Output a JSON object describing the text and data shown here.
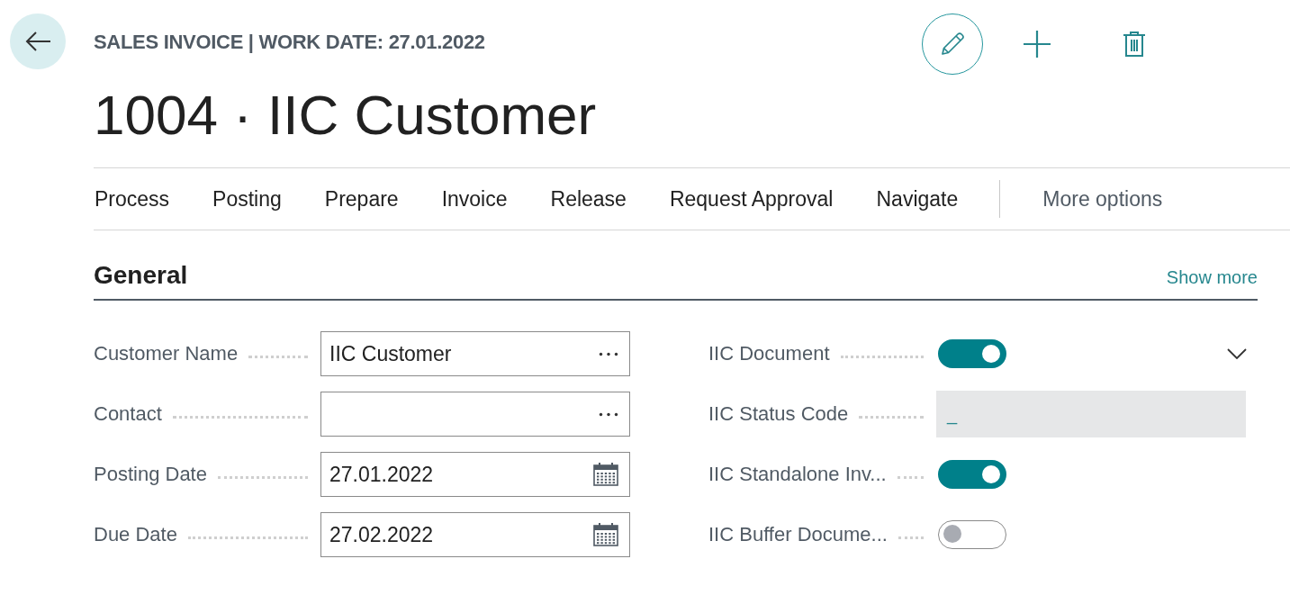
{
  "header": {
    "breadcrumb": "SALES INVOICE | WORK DATE: 27.01.2022",
    "title": "1004 · IIC Customer"
  },
  "actions": [
    {
      "label": "Process"
    },
    {
      "label": "Posting"
    },
    {
      "label": "Prepare"
    },
    {
      "label": "Invoice"
    },
    {
      "label": "Release"
    },
    {
      "label": "Request Approval"
    },
    {
      "label": "Navigate"
    }
  ],
  "more_options": "More options",
  "section": {
    "title": "General",
    "show_more": "Show more",
    "expanded": true
  },
  "left_fields": [
    {
      "kind": "lookup",
      "label": "Customer Name",
      "value": "IIC Customer"
    },
    {
      "kind": "lookup",
      "label": "Contact"
    },
    {
      "kind": "date",
      "label": "Posting Date",
      "value": "27.01.2022"
    },
    {
      "kind": "date",
      "label": "Due Date",
      "value": "27.02.2022"
    }
  ],
  "right_fields": [
    {
      "kind": "toggle",
      "label": "IIC Document",
      "on": true
    },
    {
      "kind": "readonly",
      "label": "IIC Status Code",
      "value": "_"
    },
    {
      "kind": "toggle",
      "label": "IIC Standalone Inv...",
      "on": true
    },
    {
      "kind": "toggle",
      "label": "IIC Buffer Docume...",
      "on": false
    }
  ]
}
